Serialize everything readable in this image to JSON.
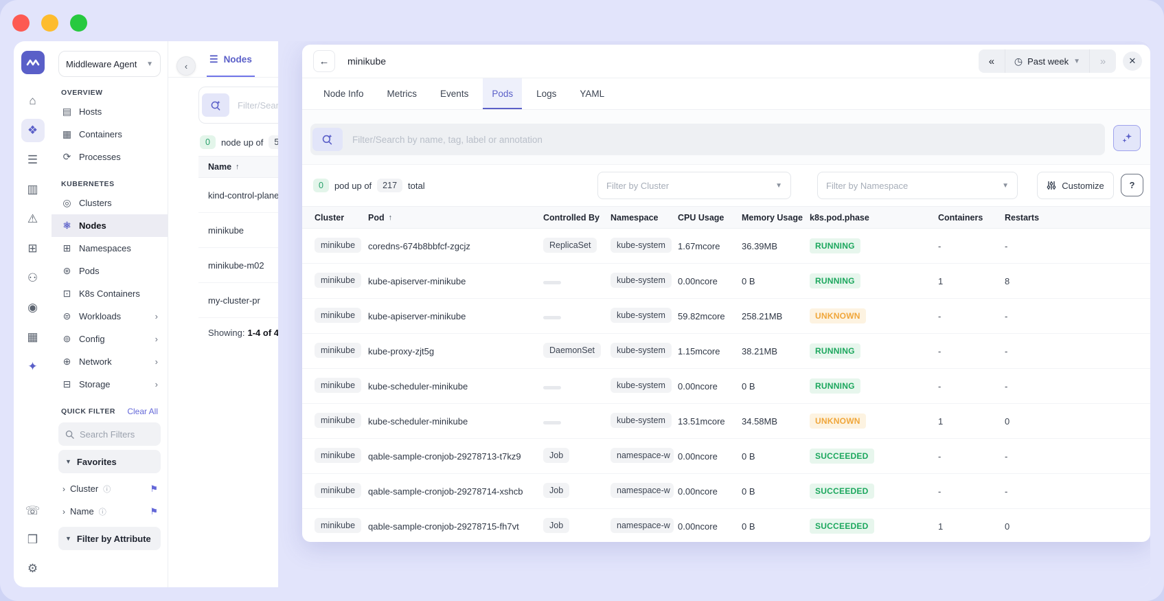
{
  "colors": {
    "accent": "#5a5fc8",
    "page_background": "#e2e4fb",
    "status_green": "#1ba75d",
    "status_orange": "#f0a63a",
    "traffic_red": "#fd5a52",
    "traffic_yellow": "#fdbc2e",
    "traffic_green": "#27c93f"
  },
  "rail": {
    "top_items": [
      {
        "name": "home-icon",
        "glyph": "⌂",
        "active": false
      },
      {
        "name": "infrastructure-icon",
        "glyph": "❖",
        "active": true
      },
      {
        "name": "logs-icon",
        "glyph": "☰",
        "active": false
      },
      {
        "name": "reports-icon",
        "glyph": "▥",
        "active": false
      },
      {
        "name": "alerts-icon",
        "glyph": "⚠",
        "active": false
      },
      {
        "name": "dashboards-icon",
        "glyph": "⊞",
        "active": false
      },
      {
        "name": "agent-icon",
        "glyph": "⚇",
        "active": false
      },
      {
        "name": "traces-icon",
        "glyph": "◉",
        "active": false
      },
      {
        "name": "resources-icon",
        "glyph": "▦",
        "active": false
      },
      {
        "name": "ai-assistant-icon",
        "glyph": "✦",
        "active": false,
        "accent": true
      }
    ],
    "bottom_items": [
      {
        "name": "support-icon",
        "glyph": "☏"
      },
      {
        "name": "packages-icon",
        "glyph": "❒"
      },
      {
        "name": "settings-icon",
        "glyph": "⚙"
      }
    ]
  },
  "sidebar": {
    "project_selector": {
      "label": "Middleware Agent"
    },
    "sections": [
      {
        "title": "OVERVIEW",
        "items": [
          {
            "label": "Hosts",
            "icon": "hosts-icon",
            "glyph": "▤"
          },
          {
            "label": "Containers",
            "icon": "containers-icon",
            "glyph": "▦"
          },
          {
            "label": "Processes",
            "icon": "processes-icon",
            "glyph": "⟳"
          }
        ]
      },
      {
        "title": "KUBERNETES",
        "items": [
          {
            "label": "Clusters",
            "icon": "clusters-icon",
            "glyph": "◎"
          },
          {
            "label": "Nodes",
            "icon": "nodes-icon",
            "glyph": "⚛",
            "active": true
          },
          {
            "label": "Namespaces",
            "icon": "namespaces-icon",
            "glyph": "⊞"
          },
          {
            "label": "Pods",
            "icon": "pods-icon",
            "glyph": "⊛"
          },
          {
            "label": "K8s Containers",
            "icon": "k8s-containers-icon",
            "glyph": "⊡"
          },
          {
            "label": "Workloads",
            "icon": "workloads-icon",
            "glyph": "⊜",
            "submenu": true
          },
          {
            "label": "Config",
            "icon": "config-icon",
            "glyph": "⊚",
            "submenu": true
          },
          {
            "label": "Network",
            "icon": "network-icon",
            "glyph": "⊕",
            "submenu": true
          },
          {
            "label": "Storage",
            "icon": "storage-icon",
            "glyph": "⊟",
            "submenu": true
          }
        ]
      }
    ],
    "quick_filter": {
      "title": "QUICK FILTER",
      "clear_all_label": "Clear All",
      "search_placeholder": "Search Filters",
      "favorites_group_label": "Favorites",
      "favorites": [
        {
          "label": "Cluster",
          "pinned": true
        },
        {
          "label": "Name",
          "pinned": true
        }
      ],
      "attribute_group_label": "Filter by Attribute"
    }
  },
  "nodes_panel": {
    "tabs": [
      {
        "label": "Nodes",
        "icon": "list-view-icon",
        "glyph": "☰",
        "active": true
      },
      {
        "label": "",
        "icon": "grid-view-icon",
        "glyph": "⊞",
        "active": false
      }
    ],
    "search_placeholder": "Filter/Search",
    "summary": {
      "up_count": "0",
      "text_between": "node up of",
      "total_count": "5"
    },
    "table": {
      "name_header": "Name",
      "sort_direction": "asc",
      "rows": [
        "kind-control-plane",
        "minikube",
        "minikube-m02",
        "my-cluster-pr"
      ],
      "showing_label": "Showing:",
      "showing_value": "1-4 of 4"
    }
  },
  "detail_panel": {
    "title": "minikube",
    "time_controls": {
      "prev_label": "«",
      "range_label": "Past week",
      "next_label": "»"
    },
    "tabs": [
      {
        "label": "Node Info",
        "active": false
      },
      {
        "label": "Metrics",
        "active": false
      },
      {
        "label": "Events",
        "active": false
      },
      {
        "label": "Pods",
        "active": true
      },
      {
        "label": "Logs",
        "active": false
      },
      {
        "label": "YAML",
        "active": false
      }
    ],
    "search_placeholder": "Filter/Search by name, tag, label or annotation",
    "summary": {
      "up_count": "0",
      "text_between": "pod up of",
      "total_count": "217",
      "text_after": "total"
    },
    "filters": {
      "cluster_placeholder": "Filter by Cluster",
      "namespace_placeholder": "Filter by Namespace",
      "customize_label": "Customize",
      "help_label": "?"
    },
    "table": {
      "columns": [
        "Cluster",
        "Pod",
        "Controlled By",
        "Namespace",
        "CPU Usage",
        "Memory Usage",
        "k8s.pod.phase",
        "Containers",
        "Restarts"
      ],
      "sorted_column": "Pod",
      "rows": [
        {
          "cluster": "minikube",
          "pod": "coredns-674b8bbfcf-zgcjz",
          "controlled_by": "ReplicaSet",
          "namespace": "kube-system",
          "cpu": "1.67mcore",
          "memory": "36.39MB",
          "phase": "RUNNING",
          "phase_color": "green",
          "containers": "-",
          "restarts": "-"
        },
        {
          "cluster": "minikube",
          "pod": "kube-apiserver-minikube",
          "controlled_by": "",
          "namespace": "kube-system",
          "cpu": "0.00ncore",
          "memory": "0 B",
          "phase": "RUNNING",
          "phase_color": "green",
          "containers": "1",
          "restarts": "8"
        },
        {
          "cluster": "minikube",
          "pod": "kube-apiserver-minikube",
          "controlled_by": "",
          "namespace": "kube-system",
          "cpu": "59.82mcore",
          "memory": "258.21MB",
          "phase": "UNKNOWN",
          "phase_color": "orange",
          "containers": "-",
          "restarts": "-"
        },
        {
          "cluster": "minikube",
          "pod": "kube-proxy-zjt5g",
          "controlled_by": "DaemonSet",
          "namespace": "kube-system",
          "cpu": "1.15mcore",
          "memory": "38.21MB",
          "phase": "RUNNING",
          "phase_color": "green",
          "containers": "-",
          "restarts": "-"
        },
        {
          "cluster": "minikube",
          "pod": "kube-scheduler-minikube",
          "controlled_by": "",
          "namespace": "kube-system",
          "cpu": "0.00ncore",
          "memory": "0 B",
          "phase": "RUNNING",
          "phase_color": "green",
          "containers": "-",
          "restarts": "-"
        },
        {
          "cluster": "minikube",
          "pod": "kube-scheduler-minikube",
          "controlled_by": "",
          "namespace": "kube-system",
          "cpu": "13.51mcore",
          "memory": "34.58MB",
          "phase": "UNKNOWN",
          "phase_color": "orange",
          "containers": "1",
          "restarts": "0"
        },
        {
          "cluster": "minikube",
          "pod": "qable-sample-cronjob-29278713-t7kz9",
          "controlled_by": "Job",
          "namespace": "namespace-w",
          "cpu": "0.00ncore",
          "memory": "0 B",
          "phase": "SUCCEEDED",
          "phase_color": "green",
          "containers": "-",
          "restarts": "-"
        },
        {
          "cluster": "minikube",
          "pod": "qable-sample-cronjob-29278714-xshcb",
          "controlled_by": "Job",
          "namespace": "namespace-w",
          "cpu": "0.00ncore",
          "memory": "0 B",
          "phase": "SUCCEEDED",
          "phase_color": "green",
          "containers": "-",
          "restarts": "-"
        },
        {
          "cluster": "minikube",
          "pod": "qable-sample-cronjob-29278715-fh7vt",
          "controlled_by": "Job",
          "namespace": "namespace-w",
          "cpu": "0.00ncore",
          "memory": "0 B",
          "phase": "SUCCEEDED",
          "phase_color": "green",
          "containers": "1",
          "restarts": "0"
        }
      ]
    }
  }
}
